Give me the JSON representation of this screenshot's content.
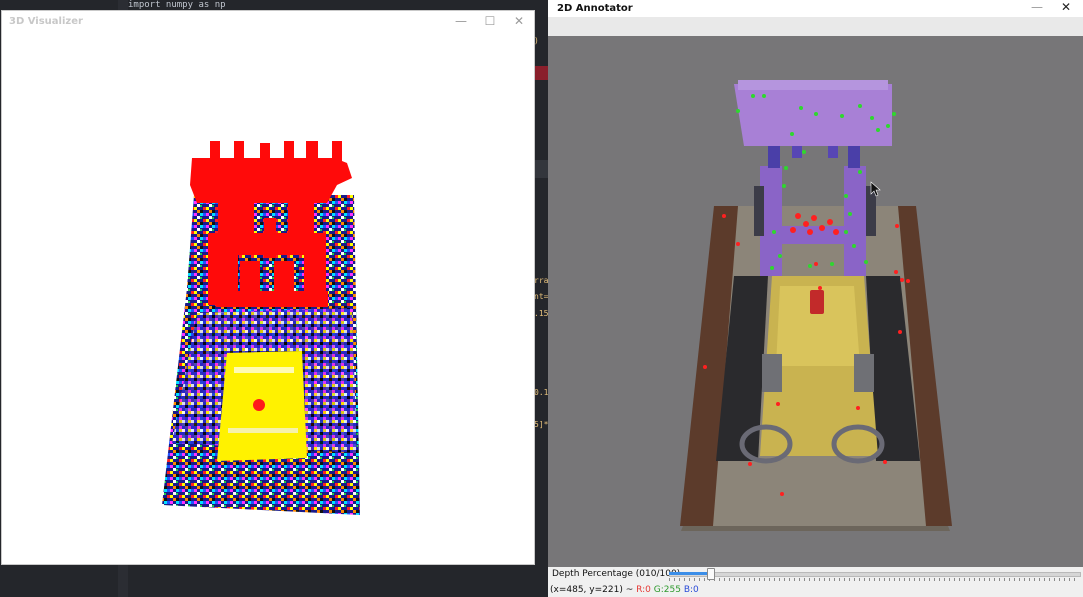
{
  "editor": {
    "top_code": "import numpy as np",
    "fragments": [
      ")",
      "rra",
      "nt=",
      ".15,",
      "0.1",
      "5]*"
    ]
  },
  "visualizer": {
    "title": "3D Visualizer",
    "controls": {
      "minimize": "—",
      "maximize": "☐",
      "close": "✕"
    }
  },
  "annotator": {
    "title": "2D Annotator",
    "controls": {
      "minimize": "—",
      "close": "✕"
    },
    "depth_label": "Depth Percentage (010/100)",
    "depth_value": 10,
    "depth_max": 100,
    "status_coords": "(x=485, y=221) ~",
    "status_r": "R:0",
    "status_g": "G:255",
    "status_b": "B:0",
    "colors": {
      "r": "#e53935",
      "g": "#2e9a2e",
      "b": "#2a4bd7"
    }
  }
}
